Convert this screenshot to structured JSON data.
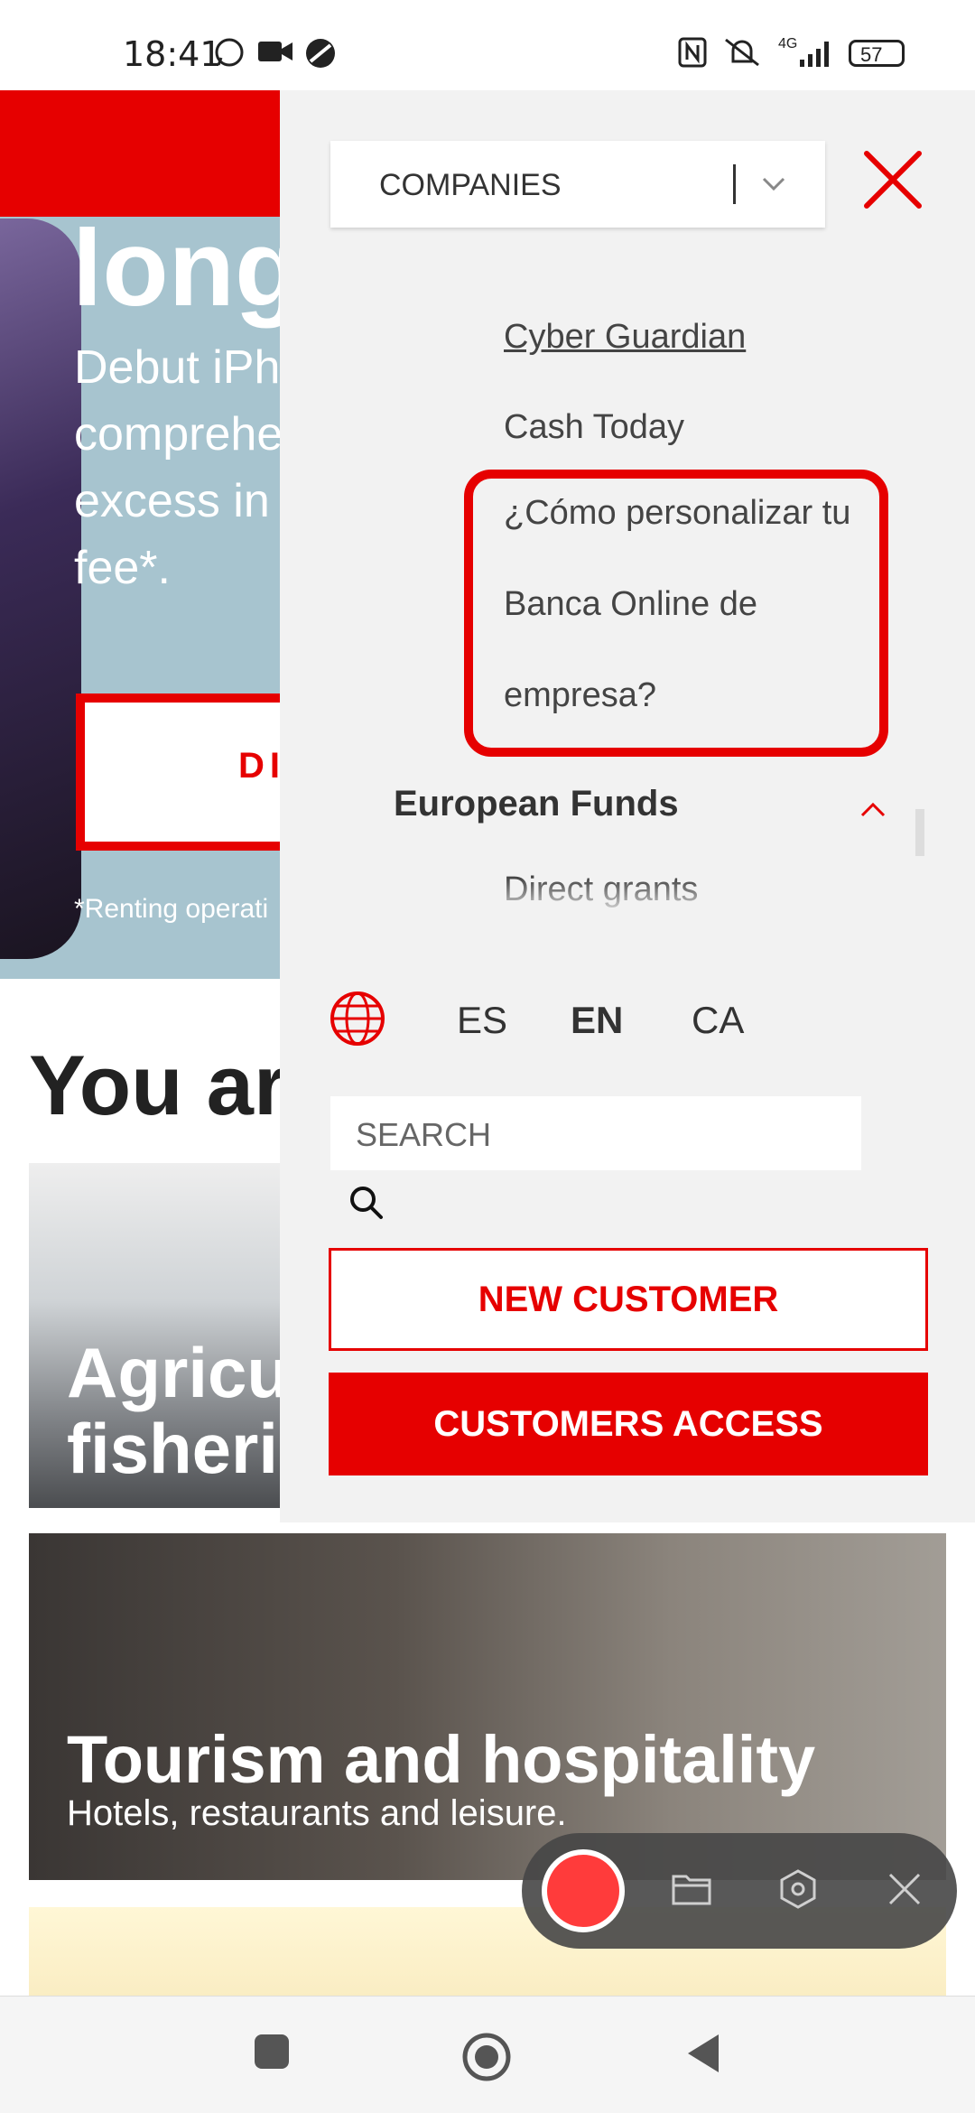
{
  "status_bar": {
    "time": "18:41",
    "battery": "57",
    "network": "4G"
  },
  "hero": {
    "title": "long",
    "text_lines": [
      "Debut iPh",
      "comprehe",
      "excess in",
      "fee*."
    ],
    "button_label": "DI",
    "note": "*Renting operati"
  },
  "section": {
    "title": "You are"
  },
  "cards": {
    "agriculture": {
      "line1": "Agricul",
      "line2": "fisherie"
    },
    "tourism": {
      "title": "Tourism and hospitality",
      "subtitle": "Hotels, restaurants and leisure."
    }
  },
  "menu": {
    "segment_select": "COMPANIES",
    "links": {
      "cyber_guardian": "Cyber Guardian",
      "cash_today": "Cash Today",
      "personalize_line1": "¿Cómo personalizar tu",
      "personalize_line2": "Banca Online de",
      "personalize_line3": "empresa?"
    },
    "section_heading": "European Funds",
    "direct_grants": "Direct grants",
    "languages": {
      "es": "ES",
      "en": "EN",
      "ca": "CA"
    },
    "search_placeholder": "SEARCH",
    "new_customer": "NEW CUSTOMER",
    "customers_access": "CUSTOMERS ACCESS"
  },
  "colors": {
    "brand_red": "#e60000",
    "menu_bg": "#f2f2f2"
  }
}
